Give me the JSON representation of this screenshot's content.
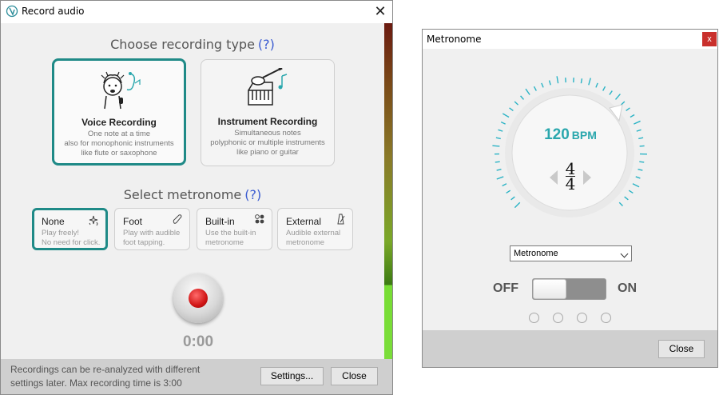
{
  "record_window": {
    "title": "Record audio",
    "close_glyph": "✕",
    "recording_type_heading": "Choose recording type",
    "help_glyph": "(?)",
    "recording_types": [
      {
        "title": "Voice Recording",
        "desc": [
          "One note at a time",
          "also for monophonic instruments",
          "like flute or saxophone"
        ],
        "selected": true,
        "icon": "singer-icon"
      },
      {
        "title": "Instrument Recording",
        "desc": [
          "Simultaneous notes",
          "polyphonic or multiple instruments",
          "like piano or guitar"
        ],
        "selected": false,
        "icon": "guitar-piano-icon"
      }
    ],
    "metronome_heading": "Select metronome",
    "metronome_options": [
      {
        "name": "None",
        "desc": [
          "Play freely!",
          "No need for click."
        ],
        "selected": true,
        "icon": "sparkle-icon"
      },
      {
        "name": "Foot",
        "desc": [
          "Play with audible",
          "foot tapping."
        ],
        "selected": false,
        "icon": "foot-icon"
      },
      {
        "name": "Built-in",
        "desc": [
          "Use the built-in",
          "metronome"
        ],
        "selected": false,
        "icon": "dots-icon"
      },
      {
        "name": "External",
        "desc": [
          "Audible external",
          "metronome"
        ],
        "selected": false,
        "icon": "metronome-icon"
      }
    ],
    "timer": "0:00",
    "footer_note": [
      "Recordings can be re-analyzed with different",
      "settings later. Max recording time is 3:00"
    ],
    "settings_button": "Settings...",
    "close_button": "Close",
    "colors": {
      "accent": "#1f8a87",
      "help_link": "#3a5bd1",
      "record_red": "#d01515"
    }
  },
  "metronome_window": {
    "title": "Metronome",
    "close_glyph": "x",
    "bpm_value": "120",
    "bpm_unit": "BPM",
    "time_signature_top": "4",
    "time_signature_bottom": "4",
    "select_value": "Metronome",
    "toggle_off_label": "OFF",
    "toggle_on_label": "ON",
    "toggle_state": "off",
    "beat_count": 4,
    "close_button": "Close",
    "colors": {
      "bpm_text": "#2aa7ad",
      "ticks": "#2ab3c5",
      "close_x_bg": "#c9302c"
    }
  }
}
